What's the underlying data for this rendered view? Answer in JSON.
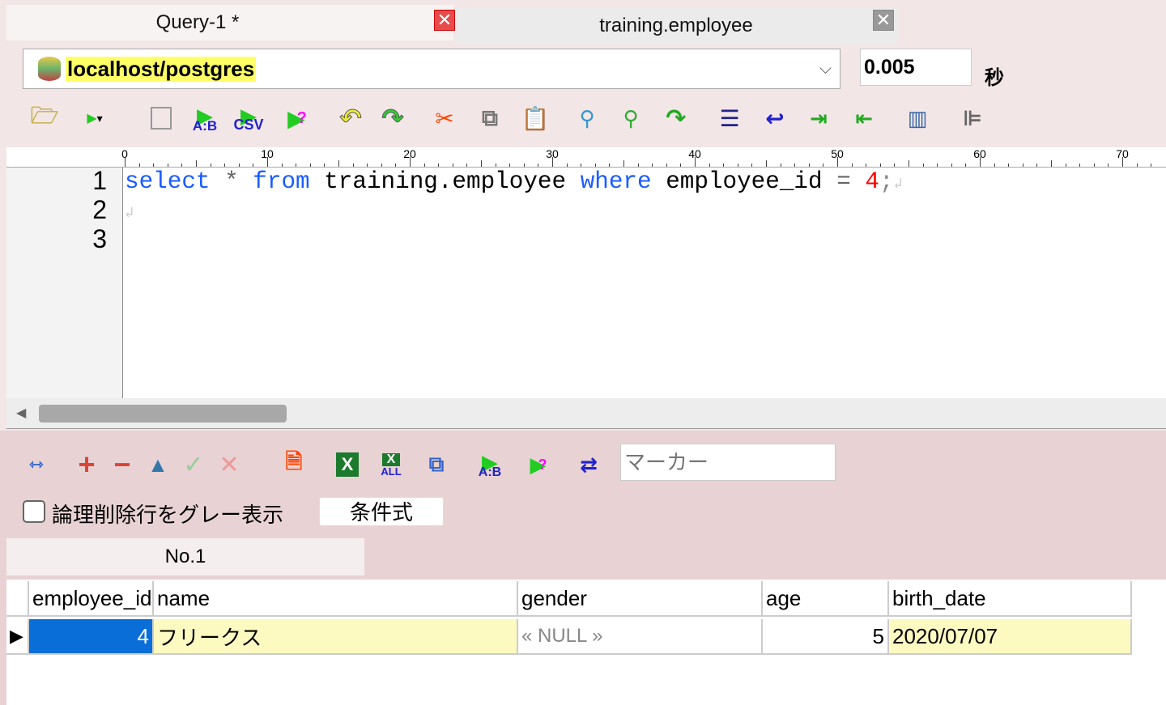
{
  "tabs": [
    {
      "label": "Query-1 *",
      "active": true
    },
    {
      "label": "training.employee",
      "active": false
    }
  ],
  "connection": {
    "value": "localhost/postgres"
  },
  "timing": {
    "value": "0.005",
    "unit": "秒"
  },
  "toolbar": [
    "open-icon",
    "execute-icon",
    "stop-icon",
    "compare-icon",
    "csv-icon",
    "explain-icon",
    "undo-icon",
    "redo-icon",
    "cut-icon",
    "copy-icon",
    "paste-icon",
    "search-icon",
    "replace-icon",
    "jump-icon",
    "align-icon",
    "wrap-icon",
    "indent-icon",
    "outdent-icon",
    "layout-icon",
    "tree-icon"
  ],
  "toolbar_labels": {
    "ab": "A:B",
    "csv": "CSV",
    "all": "ALL"
  },
  "ruler": [
    "0",
    "10",
    "20",
    "30",
    "40",
    "50",
    "60",
    "70"
  ],
  "editor": {
    "line_numbers": [
      "1",
      "2",
      "3"
    ],
    "tokens": {
      "select": "select",
      "star": "*",
      "from": "from",
      "table": "training.employee",
      "where": "where",
      "column": "employee_id",
      "eq": "=",
      "value": "4",
      ";": ";"
    }
  },
  "result_toolbar": {
    "marker_placeholder": "マーカー",
    "gray_checkbox_label": "論理削除行をグレー表示",
    "condition_button": "条件式"
  },
  "result_tabs": [
    "No.1"
  ],
  "grid": {
    "columns": [
      "employee_id",
      "name",
      "gender",
      "age",
      "birth_date"
    ],
    "rows": [
      [
        "4",
        "フリークス",
        "« NULL »",
        "5",
        "2020/07/07"
      ]
    ]
  }
}
